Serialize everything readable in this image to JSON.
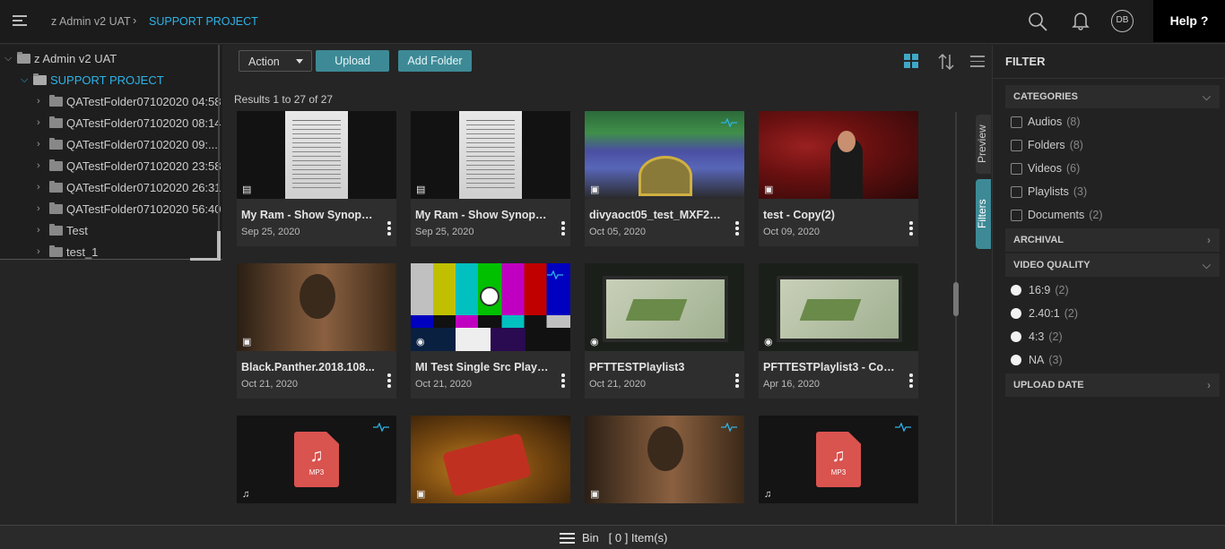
{
  "header": {
    "breadcrumb_root": "z Admin v2 UAT",
    "breadcrumb_sep": "›",
    "breadcrumb_current": "SUPPORT PROJECT",
    "avatar_initials": "DB",
    "help_label": "Help ?",
    "accent_color": "#2db3e8"
  },
  "tree": {
    "root": "z Admin v2 UAT",
    "project": "SUPPORT PROJECT",
    "folders": [
      "QATestFolder07102020 04:58",
      "QATestFolder07102020 08:14",
      "QATestFolder07102020 09:...",
      "QATestFolder07102020 23:58",
      "QATestFolder07102020 26:31",
      "QATestFolder07102020 56:40",
      "Test",
      "test_1"
    ]
  },
  "toolbar": {
    "action_label": "Action",
    "upload_label": "Upload",
    "add_folder_label": "Add Folder",
    "results_text": "Results 1 to 27 of 27"
  },
  "cards": [
    {
      "title": "My Ram - Show Synopsis...",
      "date": "Sep 25, 2020",
      "type": "document-icon"
    },
    {
      "title": "My Ram - Show Synopsis",
      "date": "Sep 25, 2020",
      "type": "document-icon"
    },
    {
      "title": "divyaoct05_test_MXF2 - ...",
      "date": "Oct 05, 2020",
      "type": "video-icon"
    },
    {
      "title": "test - Copy(2)",
      "date": "Oct 09, 2020",
      "type": "video-icon"
    },
    {
      "title": "Black.Panther.2018.108...",
      "date": "Oct 21, 2020",
      "type": "video-icon"
    },
    {
      "title": "MI Test Single Src Playli...",
      "date": "Oct 21, 2020",
      "type": "playlist-icon"
    },
    {
      "title": "PFTTESTPlaylist3",
      "date": "Oct 21, 2020",
      "type": "playlist-icon"
    },
    {
      "title": "PFTTESTPlaylist3 - Copy...",
      "date": "Apr 16, 2020",
      "type": "playlist-icon"
    },
    {
      "title": "",
      "date": "",
      "type": "audio-icon",
      "label": "MP3"
    },
    {
      "title": "",
      "date": "",
      "type": "video-icon"
    },
    {
      "title": "",
      "date": "",
      "type": "video-icon"
    },
    {
      "title": "",
      "date": "",
      "type": "audio-icon",
      "label": "MP3"
    }
  ],
  "side_tabs": {
    "preview": "Preview",
    "filters": "Filters"
  },
  "filter": {
    "title": "FILTER",
    "categories_label": "CATEGORIES",
    "categories": [
      {
        "label": "Audios",
        "count": "(8)"
      },
      {
        "label": "Folders",
        "count": "(8)"
      },
      {
        "label": "Videos",
        "count": "(6)"
      },
      {
        "label": "Playlists",
        "count": "(3)"
      },
      {
        "label": "Documents",
        "count": "(2)"
      }
    ],
    "archival_label": "ARCHIVAL",
    "video_quality_label": "VIDEO QUALITY",
    "video_quality": [
      {
        "label": "16:9",
        "count": "(2)"
      },
      {
        "label": "2.40:1",
        "count": "(2)"
      },
      {
        "label": "4:3",
        "count": "(2)"
      },
      {
        "label": "NA",
        "count": "(3)"
      }
    ],
    "upload_date_label": "UPLOAD DATE"
  },
  "bin": {
    "label": "Bin",
    "count_text": "[ 0 ] Item(s)"
  }
}
